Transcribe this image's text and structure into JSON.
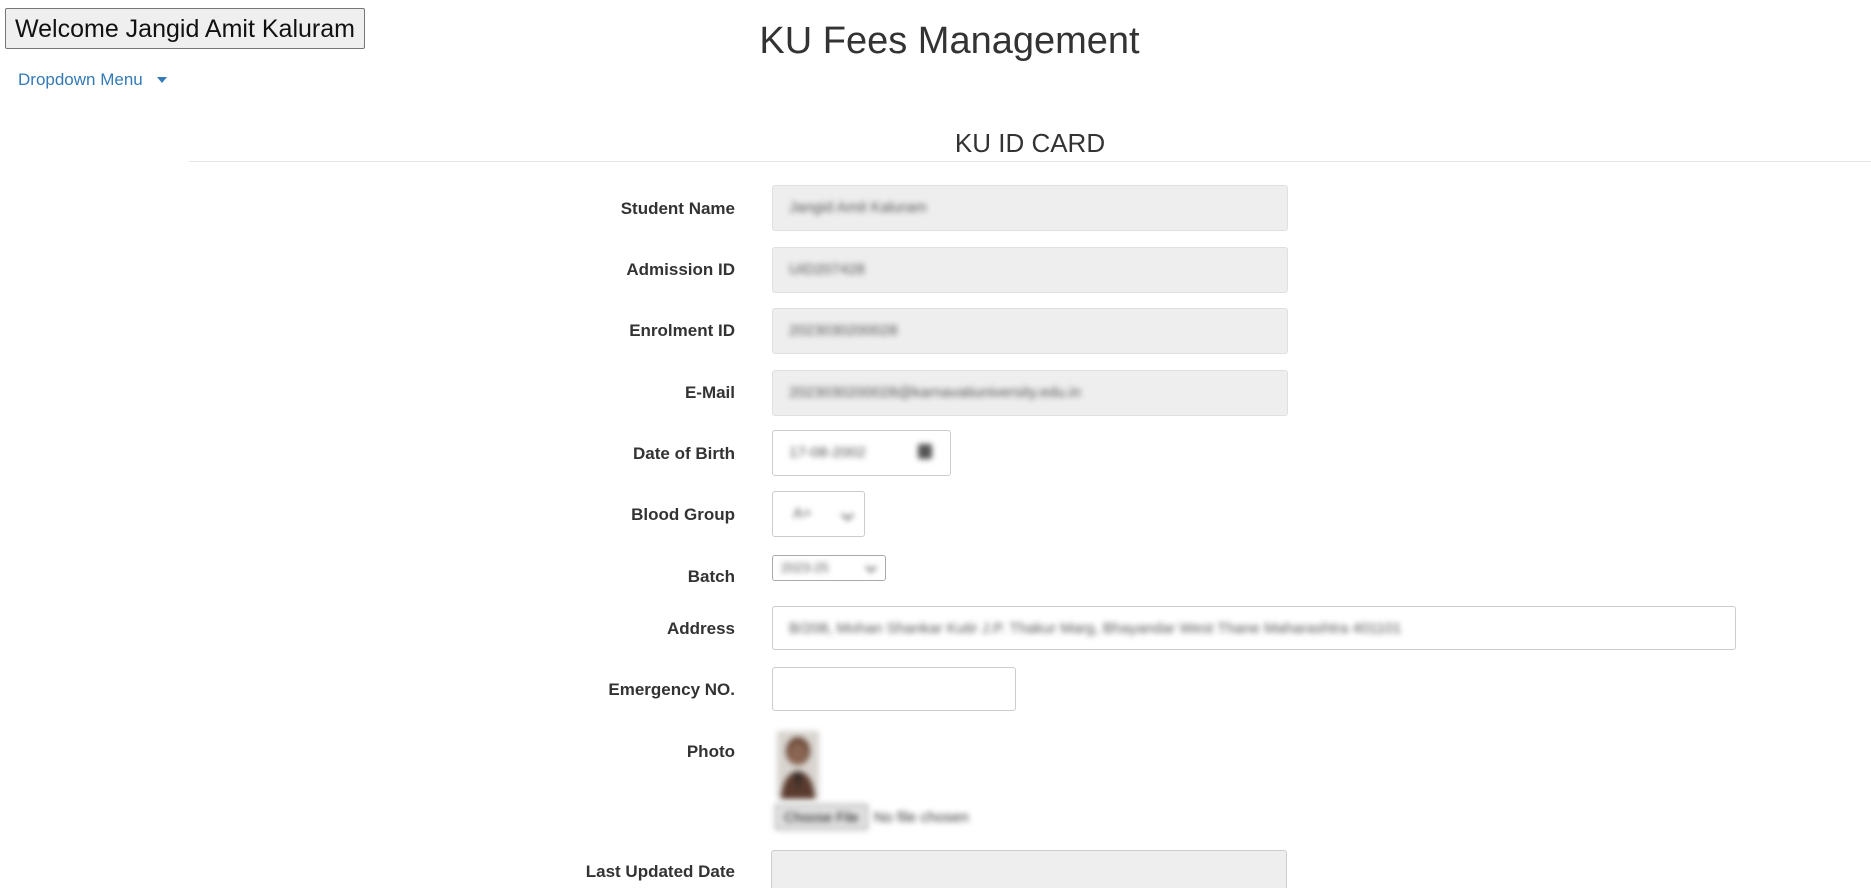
{
  "header": {
    "welcome_label": "Welcome Jangid Amit Kaluram",
    "app_title": "KU Fees Management",
    "dropdown_label": "Dropdown Menu"
  },
  "card": {
    "title": "KU ID CARD"
  },
  "form": {
    "student_name": {
      "label": "Student Name",
      "value": "Jangid Amit Kaluram"
    },
    "admission_id": {
      "label": "Admission ID",
      "value": "UID207428"
    },
    "enrolment_id": {
      "label": "Enrolment ID",
      "value": "2023030200028"
    },
    "email": {
      "label": "E-Mail",
      "value": "2023030200028@karnavatiuniversity.edu.in"
    },
    "date_of_birth": {
      "label": "Date of Birth",
      "value": "17-08-2002",
      "icon": "calendar-icon"
    },
    "blood_group": {
      "label": "Blood Group",
      "value": "A+"
    },
    "batch": {
      "label": "Batch",
      "value": "2023-25"
    },
    "address": {
      "label": "Address",
      "value": "B/208, Mohan Shankar Kutir J.P. Thakur Marg, Bhayandar West Thane Maharashtra 401101"
    },
    "emergency_no": {
      "label": "Emergency NO.",
      "value": ""
    },
    "photo": {
      "label": "Photo",
      "choose_file_label": "Choose File",
      "no_file_text": "No file chosen"
    },
    "last_updated_date": {
      "label": "Last Updated Date",
      "value": ""
    }
  },
  "colors": {
    "link": "#337ab7",
    "readonly_bg": "#eeeeee",
    "text": "#333333"
  }
}
